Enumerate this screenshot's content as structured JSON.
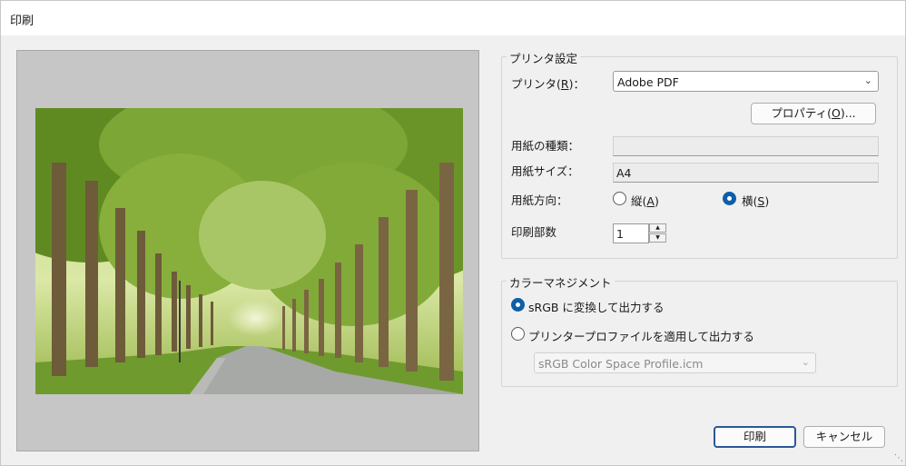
{
  "window": {
    "title": "印刷"
  },
  "printer_settings": {
    "legend": "プリンタ設定",
    "printer_label_pre": "プリンタ(",
    "printer_label_key": "R",
    "printer_label_post": ")：",
    "printer_value": "Adobe PDF",
    "properties_button_pre": "プロパティ(",
    "properties_button_key": "O",
    "properties_button_post": ")...",
    "paper_type_label": "用紙の種類：",
    "paper_type_value": "",
    "paper_size_label": "用紙サイズ：",
    "paper_size_value": "A4",
    "orientation_label": "用紙方向：",
    "portrait_pre": "縦(",
    "portrait_key": "A",
    "portrait_post": ")",
    "landscape_pre": "横(",
    "landscape_key": "S",
    "landscape_post": ")",
    "orientation_selected": "landscape",
    "copies_label": "印刷部数",
    "copies_value": "1"
  },
  "color_management": {
    "legend": "カラーマネジメント",
    "option_srgb": "sRGB に変換して出力する",
    "option_profile": "プリンタープロファイルを適用して出力する",
    "selected": "srgb",
    "profile_value": "sRGB Color Space Profile.icm"
  },
  "buttons": {
    "print": "印刷",
    "cancel": "キャンセル"
  },
  "icons": {
    "dropdown": "chevron-down-icon",
    "spin_up": "spin-up-icon",
    "spin_down": "spin-down-icon",
    "resize": "resize-grip-icon"
  },
  "colors": {
    "accent": "#0f5ea8",
    "preview_bg": "#c6c6c6",
    "dialog_bg": "#f0f0f0"
  }
}
